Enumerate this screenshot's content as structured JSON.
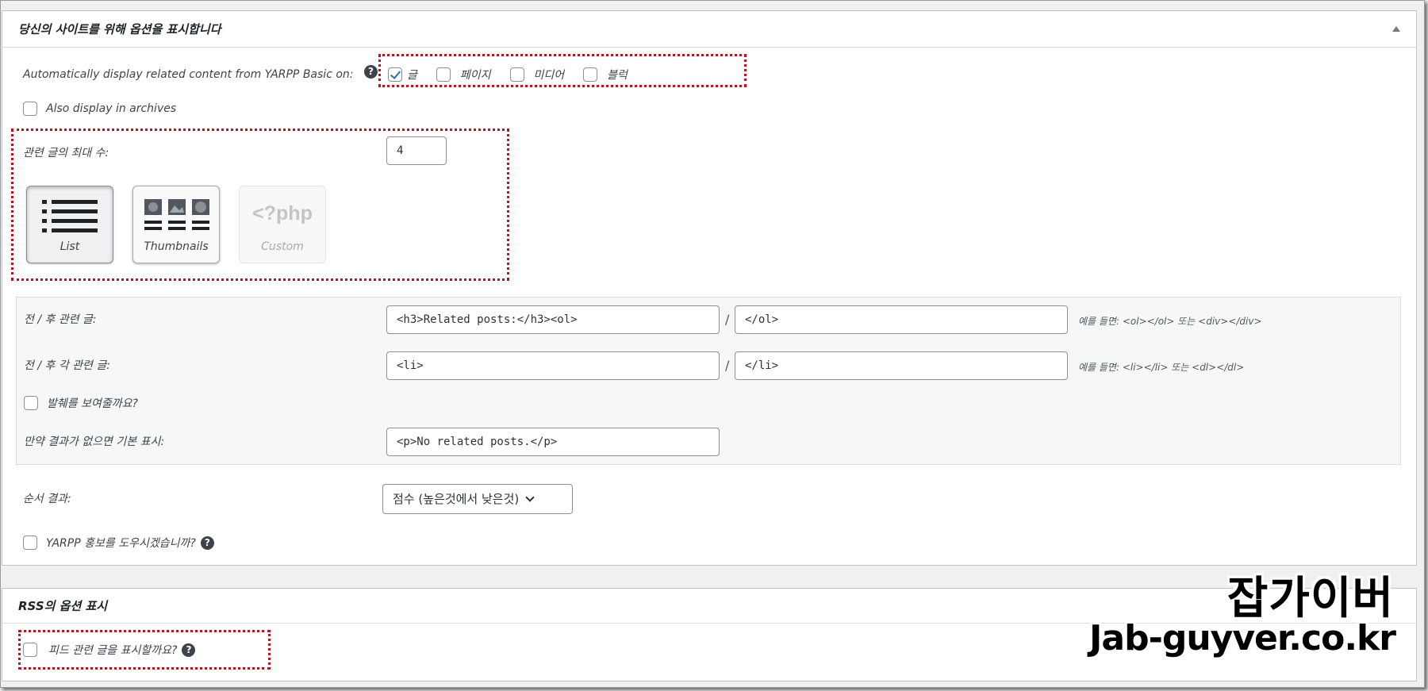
{
  "display_panel": {
    "title": "당신의 사이트를 위해 옵션을 표시합니다",
    "auto_display_label": "Automatically display related content from YARPP Basic on:",
    "post_types": [
      {
        "label": "글",
        "checked": true
      },
      {
        "label": "페이지",
        "checked": false
      },
      {
        "label": "미디어",
        "checked": false
      },
      {
        "label": "블럭",
        "checked": false
      }
    ],
    "archives_label": "Also display in archives",
    "max_posts_label": "관련 글의 최대 수:",
    "max_posts_value": "4",
    "templates": [
      {
        "label": "List",
        "icon": "list-icon",
        "state": "active"
      },
      {
        "label": "Thumbnails",
        "icon": "thumbnails-icon",
        "state": "selected"
      },
      {
        "label": "Custom",
        "icon": "php-icon",
        "state": "disabled",
        "icon_text": "<?php"
      }
    ],
    "before_after_label": "전 / 후 관련 글:",
    "before_value": "<h3>Related posts:</h3><ol>",
    "after_value": "</ol>",
    "before_after_hint": "예를 들면: <ol></ol> 또는 <div></div>",
    "each_label": "전 / 후 각 관련 글:",
    "each_before_value": "<li>",
    "each_after_value": "</li>",
    "each_hint": "예를 들면: <li></li> 또는 <dl></dl>",
    "separator": "/",
    "excerpt_label": "발췌를 보여줄까요?",
    "no_results_label": "만약 결과가 없으면 기본 표시:",
    "no_results_value": "<p>No related posts.</p>",
    "order_label": "순서 결과:",
    "order_value": "점수 (높은것에서 낮은것)",
    "promote_label": "YARPP 홍보를 도우시겠습니까?",
    "help_glyph": "?"
  },
  "rss_panel": {
    "title": "RSS의 옵션 표시",
    "feed_label": "피드 관련 글을 표시할까요?"
  },
  "watermark": {
    "korean": "잡가이버",
    "domain": "Jab-guyver.co.kr"
  },
  "colors": {
    "highlight_red": "#c0121e",
    "check_blue": "#2271b1"
  }
}
